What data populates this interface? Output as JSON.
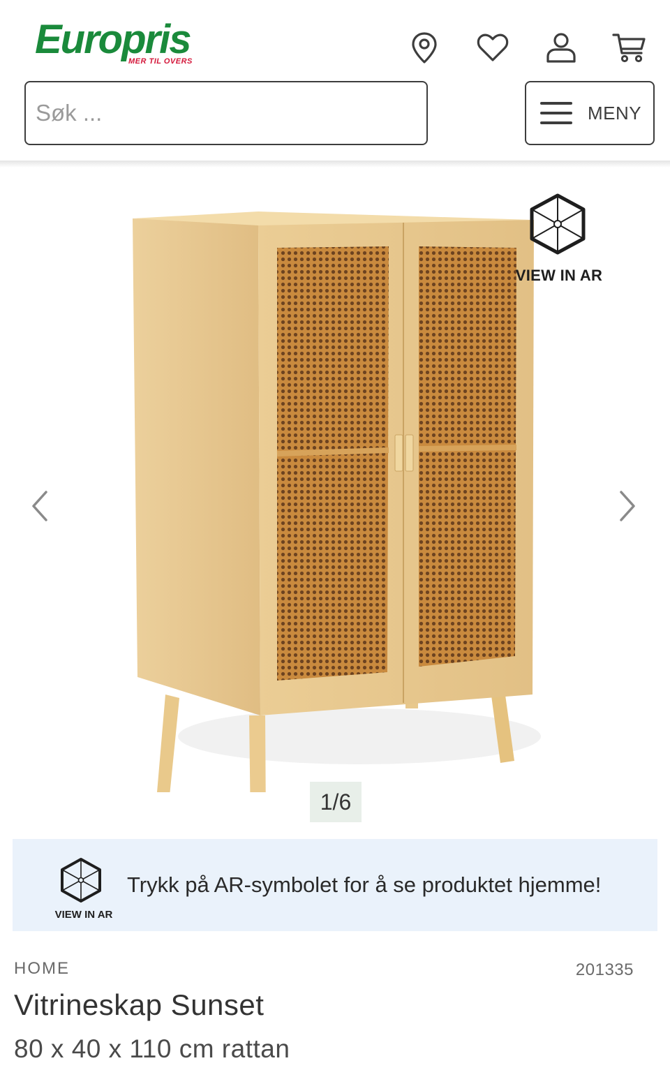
{
  "header": {
    "logo_text": "Europris",
    "logo_tagline": "MER TIL OVERS",
    "icons": [
      "location-pin-icon",
      "heart-icon",
      "user-icon",
      "cart-icon"
    ],
    "search": {
      "placeholder": "Søk ...",
      "value": ""
    },
    "menu_label": "MENY"
  },
  "gallery": {
    "ar_label": "VIEW IN AR",
    "pager": "1/6",
    "icons": [
      "chevron-left-icon",
      "chevron-right-icon",
      "ar-cube-icon"
    ]
  },
  "ar_banner": {
    "ar_label": "VIEW IN AR",
    "text": "Trykk på AR-symbolet for å se produktet hjemme!"
  },
  "product": {
    "brand": "HOME",
    "sku": "201335",
    "title": "Vitrineskap Sunset",
    "subtitle": "80 x 40 x 110 cm rattan"
  },
  "colors": {
    "brand_green": "#1a8a3b",
    "brand_red": "#d4173a",
    "banner_bg": "#eaf2fb",
    "pager_bg": "#e8efe9"
  }
}
